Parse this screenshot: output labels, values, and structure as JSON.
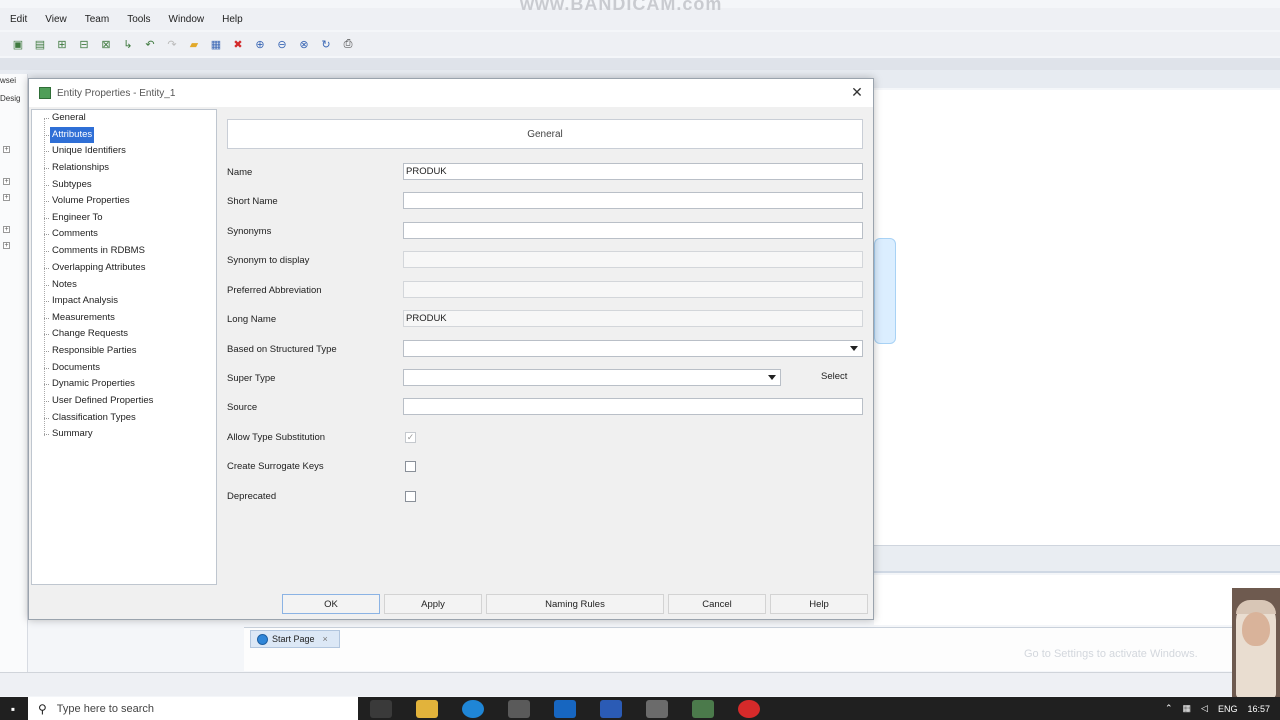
{
  "watermark": "www.BANDICAM.com",
  "menubar": [
    "Edit",
    "View",
    "Team",
    "Tools",
    "Window",
    "Help"
  ],
  "toolbar_icons": [
    "new-icon",
    "open-icon",
    "entity-icon",
    "view-icon",
    "relation-icon",
    "arrow-icon",
    "undo-icon",
    "redo-icon",
    "folder-icon",
    "grid-icon",
    "delete-icon",
    "zoom-in-icon",
    "zoom-out-icon",
    "fit-icon",
    "refresh-icon",
    "print-icon"
  ],
  "left_strip": [
    "wsei",
    "Desig"
  ],
  "dialog": {
    "title": "Entity Properties - Entity_1",
    "nav_items": [
      "General",
      "Attributes",
      "Unique Identifiers",
      "Relationships",
      "Subtypes",
      "Volume Properties",
      "Engineer To",
      "Comments",
      "Comments in RDBMS",
      "Overlapping Attributes",
      "Notes",
      "Impact Analysis",
      "Measurements",
      "Change Requests",
      "Responsible Parties",
      "Documents",
      "Dynamic Properties",
      "User Defined Properties",
      "Classification Types",
      "Summary"
    ],
    "selected_nav": 1,
    "panel_title": "General",
    "fields": {
      "name": {
        "label": "Name",
        "value": "PRODUK"
      },
      "short_name": {
        "label": "Short Name",
        "value": ""
      },
      "synonyms": {
        "label": "Synonyms",
        "value": ""
      },
      "synonym_display": {
        "label": "Synonym to display",
        "value": ""
      },
      "preferred_abbrev": {
        "label": "Preferred Abbreviation",
        "value": ""
      },
      "long_name": {
        "label": "Long Name",
        "value": "PRODUK"
      },
      "structured_type": {
        "label": "Based on Structured Type",
        "value": ""
      },
      "super_type": {
        "label": "Super Type",
        "value": ""
      },
      "source": {
        "label": "Source",
        "value": ""
      }
    },
    "select_label": "Select",
    "checkboxes": {
      "allow_type_subst": {
        "label": "Allow Type Substitution",
        "checked": true,
        "disabled": true
      },
      "surrogate_keys": {
        "label": "Create Surrogate Keys",
        "checked": false
      },
      "deprecated": {
        "label": "Deprecated",
        "checked": false
      }
    },
    "buttons": {
      "ok": "OK",
      "apply": "Apply",
      "naming_rules": "Naming Rules",
      "cancel": "Cancel",
      "help": "Help"
    }
  },
  "start_page_tab": "Start Page",
  "activate_text": "Go to Settings to activate Windows.",
  "taskbar": {
    "search_placeholder": "Type here to search",
    "lang": "ENG",
    "time": "16:57"
  }
}
